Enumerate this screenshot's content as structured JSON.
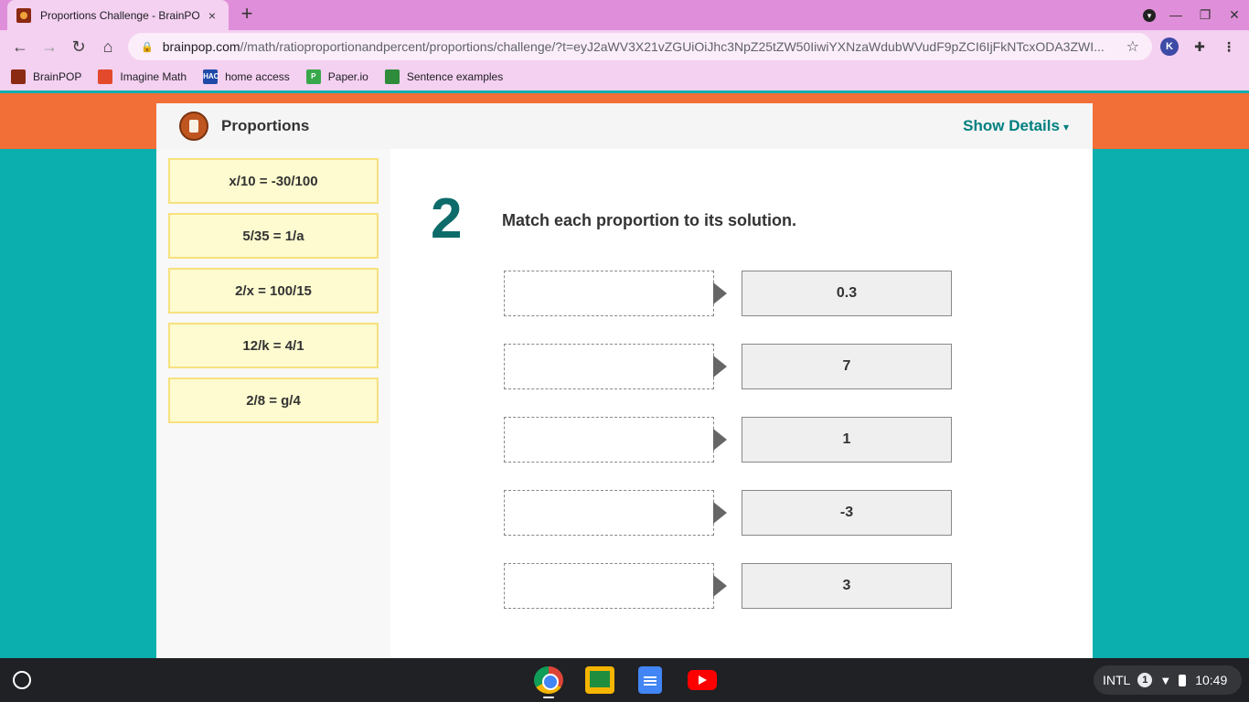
{
  "browser": {
    "tab_title": "Proportions Challenge - BrainPOP",
    "tab_close": "×",
    "new_tab": "+",
    "url_host": "brainpop.com",
    "url_rest": "//math/ratioproportionandpercent/proportions/challenge/?t=eyJ2aWV3X21vZGUiOiJhc3NpZ25tZW50IiwiYXNzaWdubWVudF9pZCI6IjFkNTcxODA3ZWI...",
    "bookmarks": [
      {
        "label": "BrainPOP",
        "icon": "brainpop-icon",
        "color": "#8a2a12"
      },
      {
        "label": "Imagine Math",
        "icon": "imagine-math-icon",
        "color": "#e24a2b"
      },
      {
        "label": "home access",
        "icon": "hac-icon",
        "color": "#1f4aa8"
      },
      {
        "label": "Paper.io",
        "icon": "paperio-icon",
        "color": "#39a84a"
      },
      {
        "label": "Sentence examples",
        "icon": "sentence-icon",
        "color": "#2f8c3a"
      }
    ]
  },
  "page": {
    "title": "Proportions",
    "show_details": "Show Details",
    "question_number": "2",
    "question_text": "Match each proportion to its solution.",
    "answers": [
      "x/10 = -30/100",
      "5/35 = 1/a",
      "2/x = 100/15",
      "12/k = 4/1",
      "2/8 = g/4"
    ],
    "solutions": [
      "0.3",
      "7",
      "1",
      "-3",
      "3"
    ]
  },
  "taskbar": {
    "ime": "INTL",
    "notification_count": "1",
    "time": "10:49"
  },
  "colors": {
    "page_bg": "#0bafae",
    "header_band": "#f26f38",
    "accent_teal": "#007f80",
    "chip_bg": "#fdfbcf",
    "chrome_frame": "#df8fd9"
  }
}
